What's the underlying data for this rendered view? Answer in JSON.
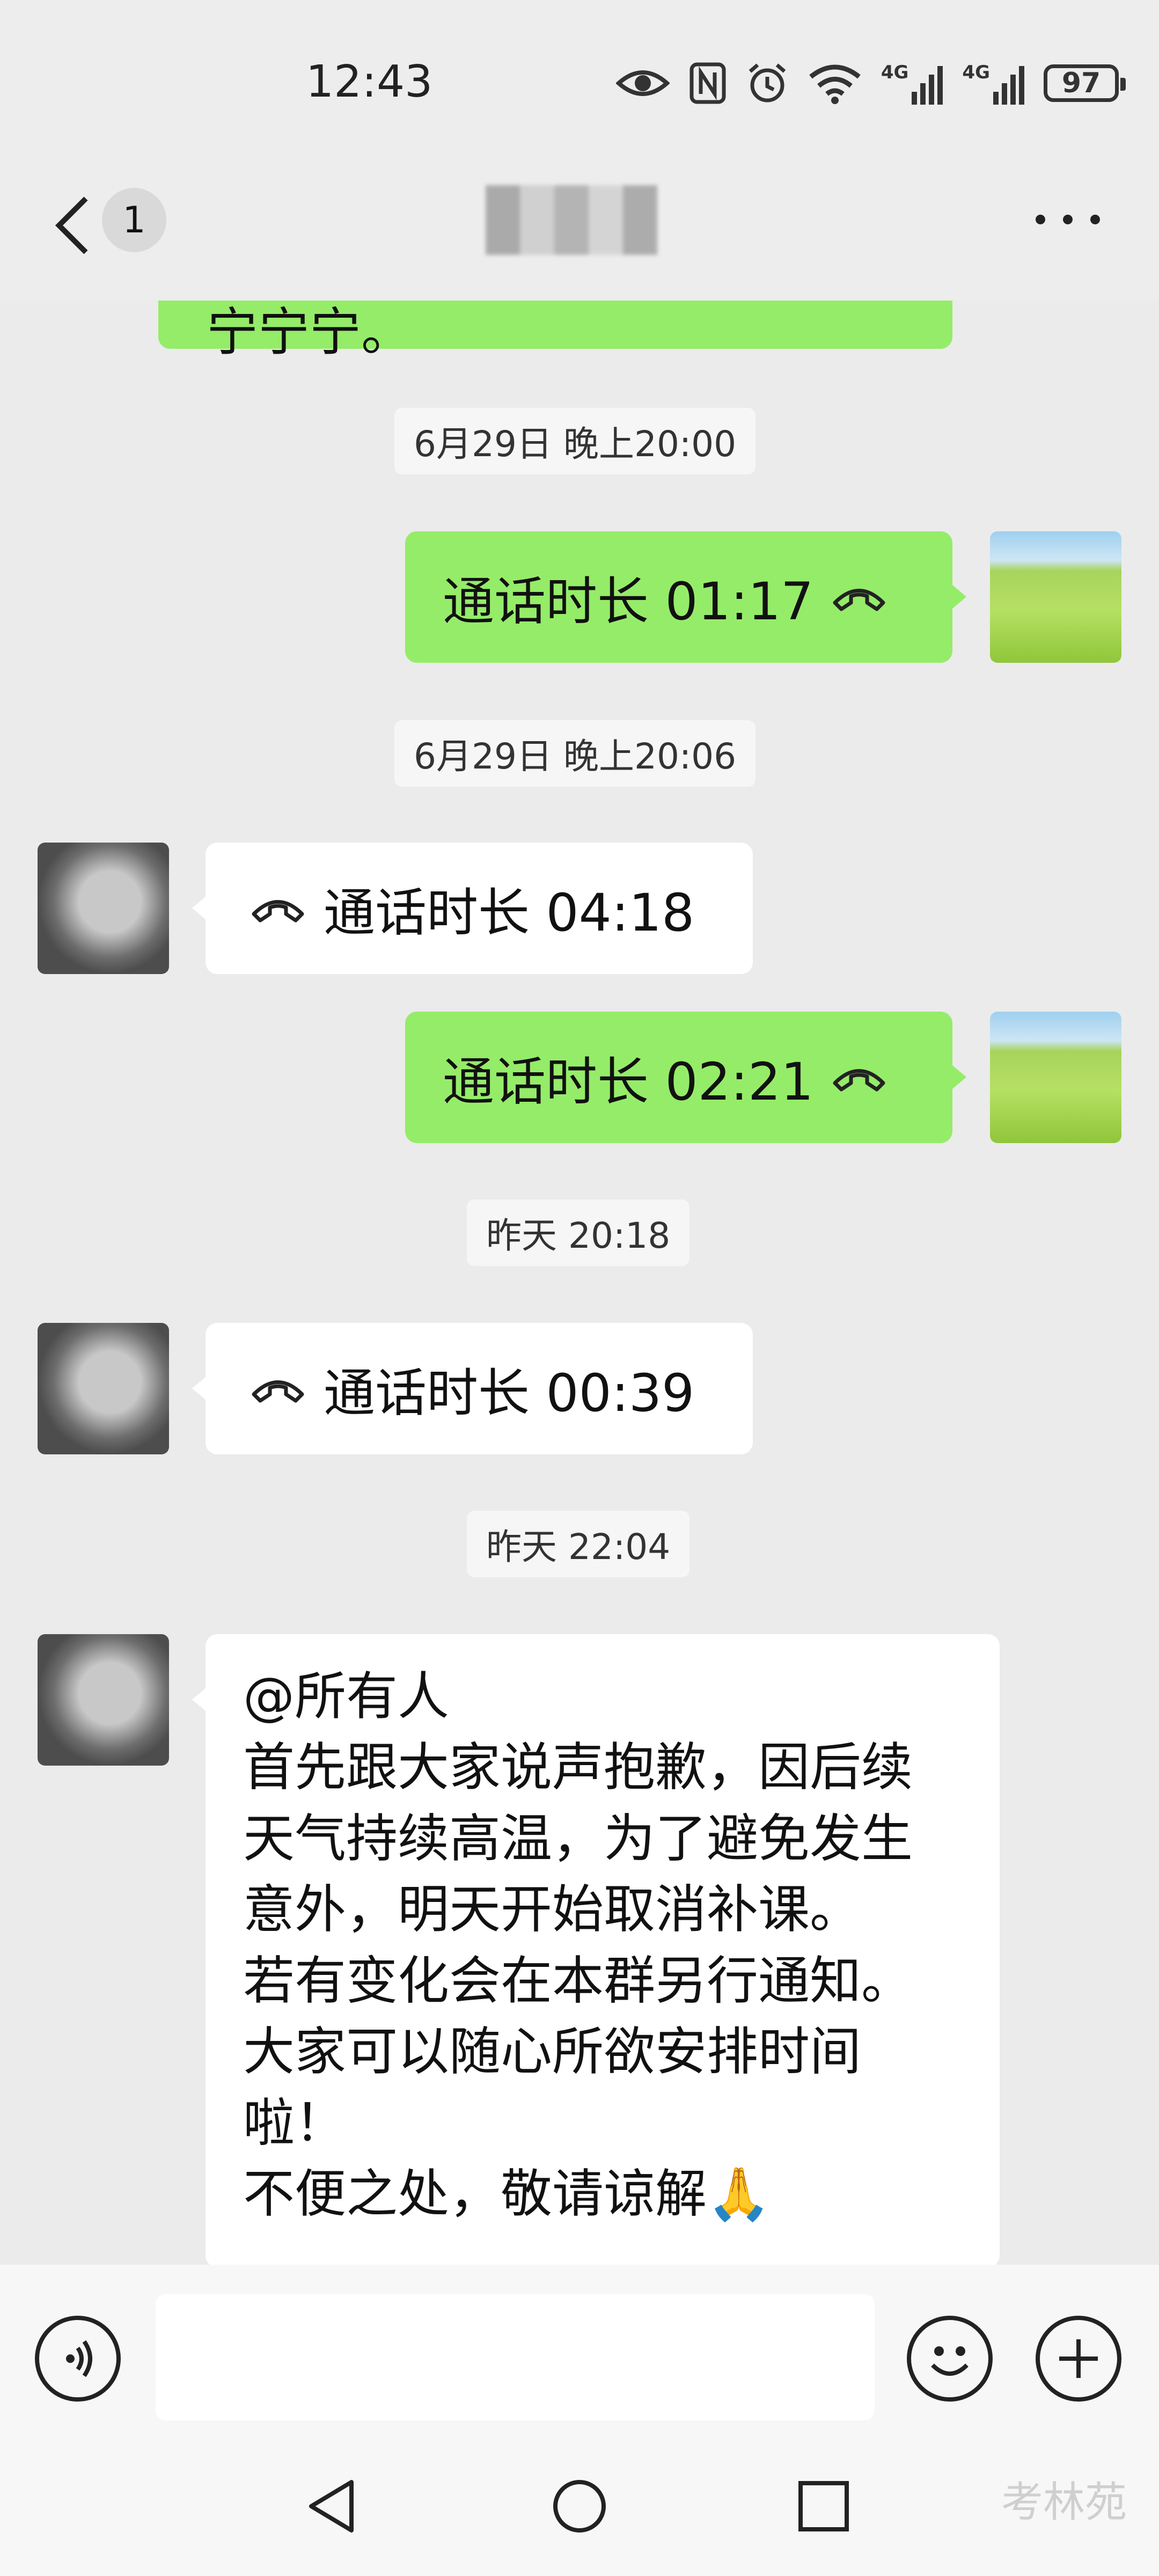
{
  "status_bar": {
    "time": "12:43",
    "signal1_label": "4G",
    "signal2_label": "4G",
    "battery": "97"
  },
  "header": {
    "unread_count": "1"
  },
  "messages": {
    "partial_top": "宁宁宁。",
    "ts1": "6月29日 晚上20:00",
    "call1": "通话时长 01:17",
    "ts2": "6月29日 晚上20:06",
    "call2": "通话时长 04:18",
    "call3": "通话时长 02:21",
    "ts3": "昨天 20:18",
    "call4": "通话时长 00:39",
    "ts4": "昨天 22:04",
    "notice": "@所有人\n首先跟大家说声抱歉，因后续\n天气持续高温，为了避免发生\n意外，明天开始取消补课。\n若有变化会在本群另行通知。\n大家可以随心所欲安排时间\n啦！\n不便之处，敬请谅解🙏"
  },
  "watermark": "考林苑",
  "colors": {
    "sent_bubble": "#95ec69",
    "received_bubble": "#ffffff",
    "chat_bg": "#ebebeb"
  },
  "icons": [
    "eye-icon",
    "nfc-icon",
    "alarm-icon",
    "wifi-icon",
    "signal-icon",
    "battery-icon",
    "back-chevron-icon",
    "more-dots-icon",
    "phone-hangup-icon",
    "voice-icon",
    "emoji-icon",
    "plus-icon",
    "nav-back-icon",
    "nav-home-icon",
    "nav-recents-icon"
  ]
}
